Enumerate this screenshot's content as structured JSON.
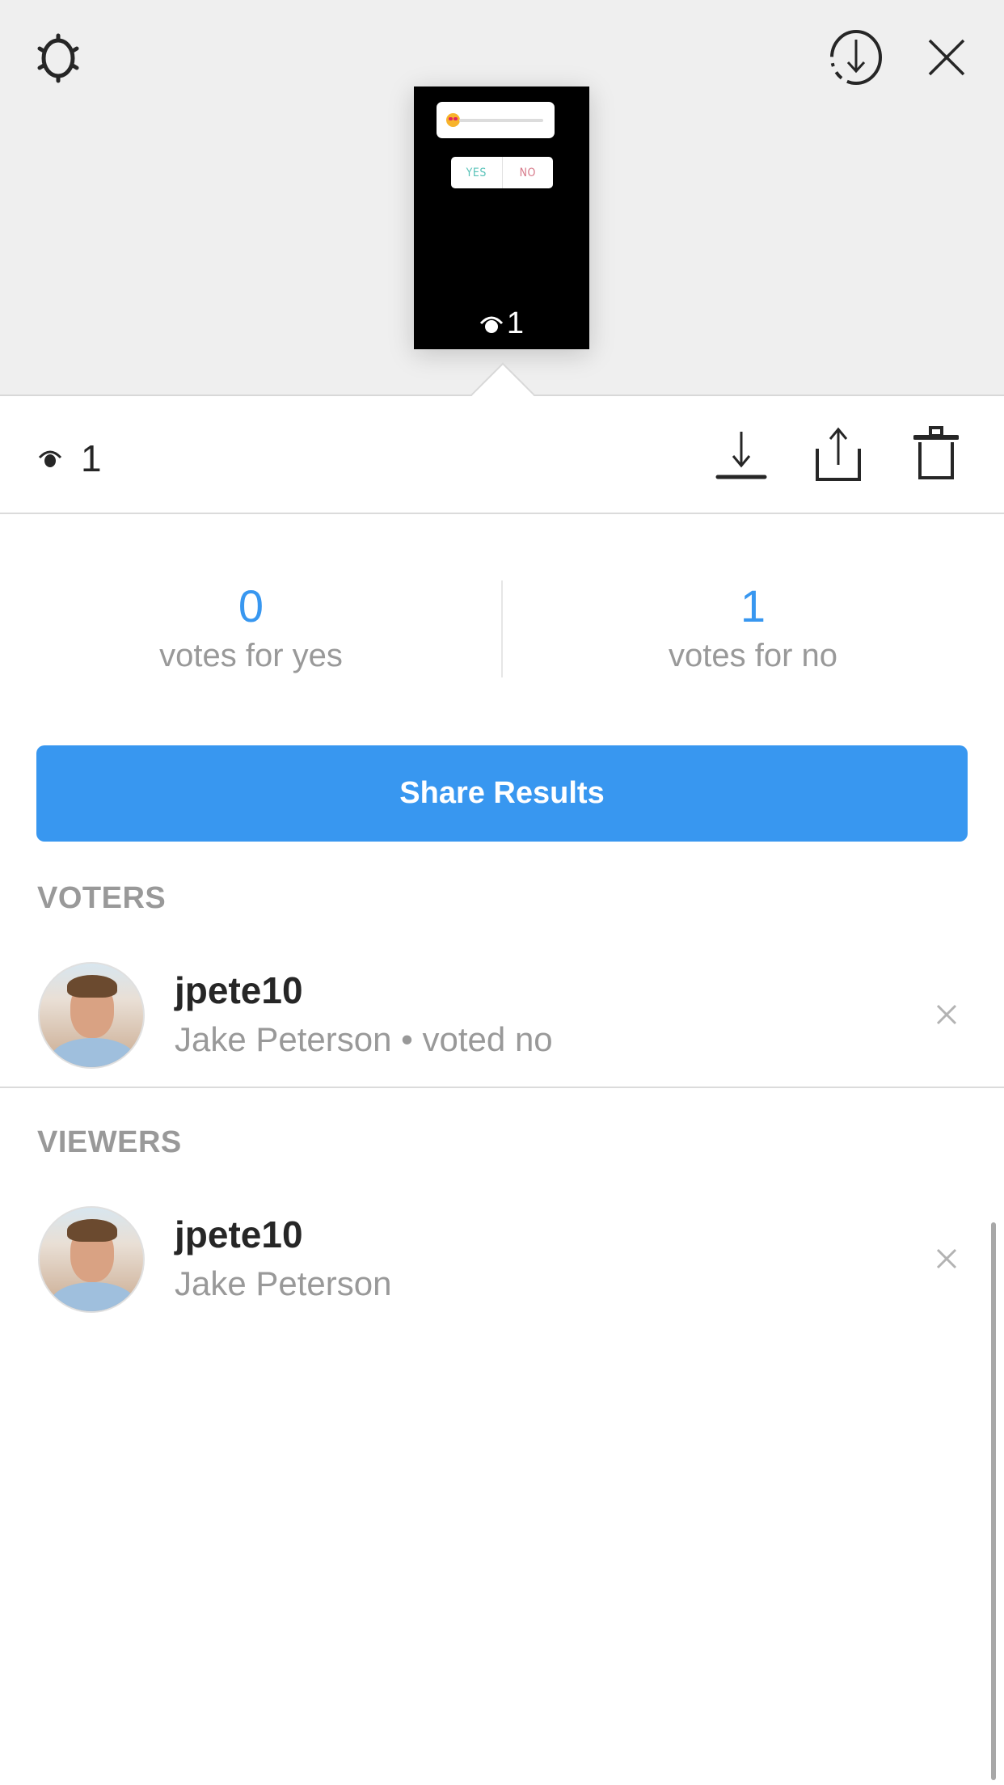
{
  "header": {
    "settings_icon": "gear-icon",
    "save_all_icon": "download-circle-icon",
    "close_icon": "close-icon"
  },
  "story_thumbnail": {
    "slider_emoji": "heart-eyes-emoji",
    "poll_options": [
      "YES",
      "NO"
    ],
    "view_count": "1",
    "colors": {
      "yes": "#57c2b8",
      "no": "#d77a8a"
    }
  },
  "toolbar": {
    "view_icon": "eye-icon",
    "view_count": "1",
    "actions": [
      {
        "name": "download",
        "icon": "download-icon"
      },
      {
        "name": "share",
        "icon": "share-icon"
      },
      {
        "name": "delete",
        "icon": "trash-icon"
      }
    ]
  },
  "poll_results": {
    "yes": {
      "count": "0",
      "label": "votes for yes"
    },
    "no": {
      "count": "1",
      "label": "votes for no"
    },
    "accent_color": "#3897f0"
  },
  "share_button": {
    "label": "Share Results",
    "color": "#3897f0"
  },
  "voters": {
    "title": "VOTERS",
    "items": [
      {
        "username": "jpete10",
        "subtitle": "Jake Peterson • voted no"
      }
    ]
  },
  "viewers": {
    "title": "VIEWERS",
    "items": [
      {
        "username": "jpete10",
        "subtitle": "Jake Peterson"
      }
    ]
  }
}
